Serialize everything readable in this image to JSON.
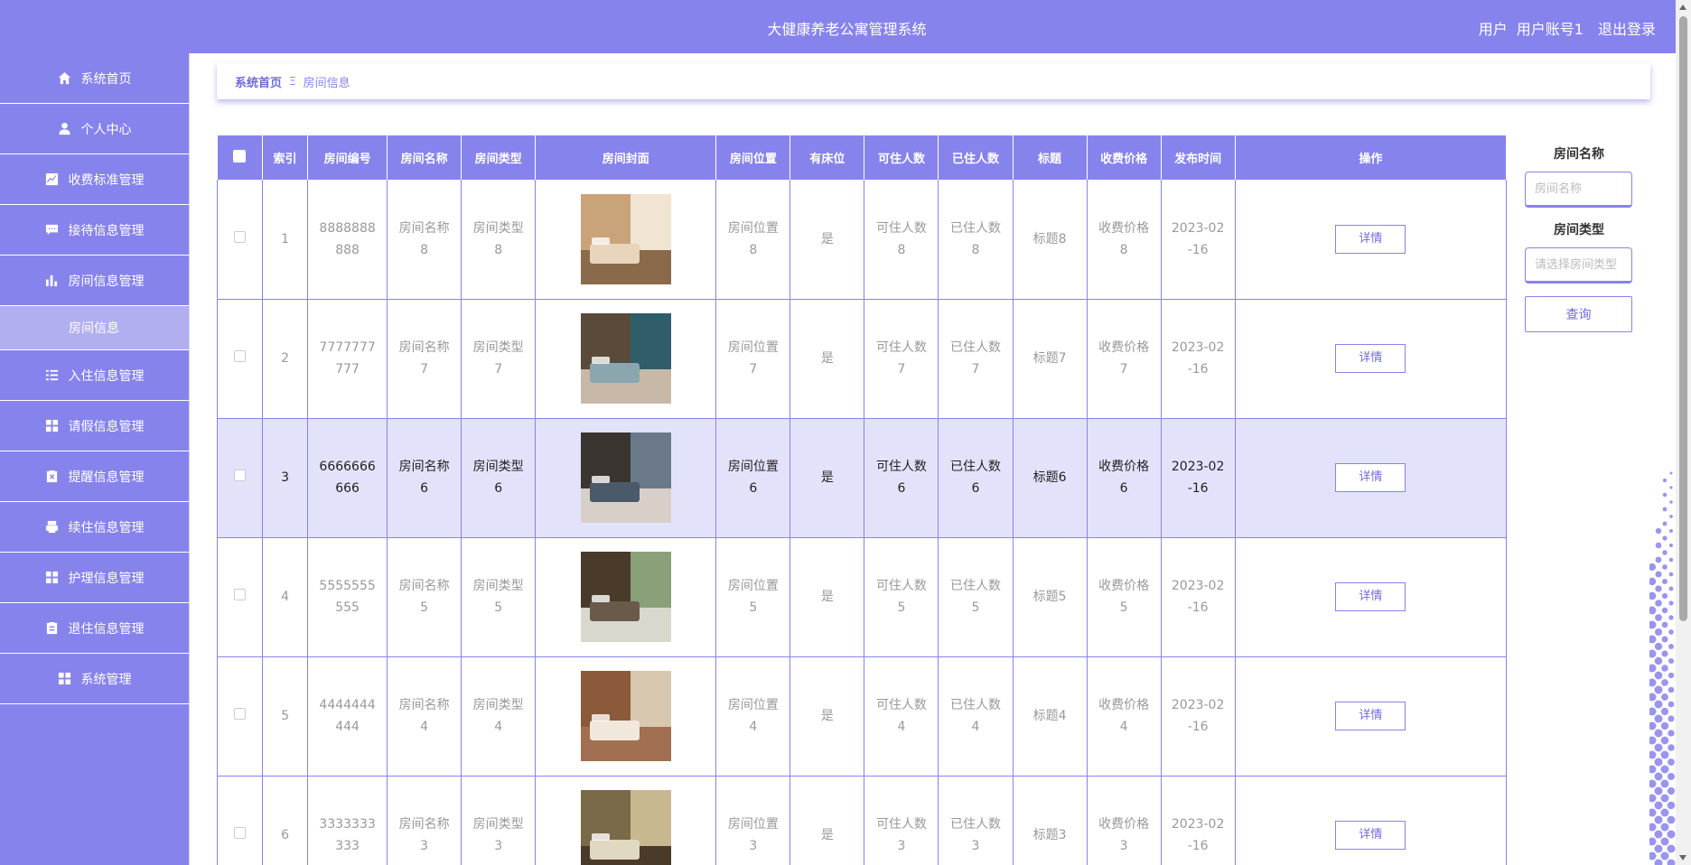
{
  "header": {
    "title": "大健康养老公寓管理系统",
    "role": "用户",
    "account": "用户账号1",
    "logout": "退出登录"
  },
  "sidebar": {
    "items": [
      {
        "label": "系统首页",
        "icon": "home-icon"
      },
      {
        "label": "个人中心",
        "icon": "user-icon"
      },
      {
        "label": "收费标准管理",
        "icon": "chart-line-icon"
      },
      {
        "label": "接待信息管理",
        "icon": "chat-icon"
      },
      {
        "label": "房间信息管理",
        "icon": "bar-chart-icon"
      },
      {
        "label": "房间信息",
        "icon": ""
      },
      {
        "label": "入住信息管理",
        "icon": "list-icon"
      },
      {
        "label": "请假信息管理",
        "icon": "grid-icon"
      },
      {
        "label": "提醒信息管理",
        "icon": "clipboard-x-icon"
      },
      {
        "label": "续住信息管理",
        "icon": "printer-icon"
      },
      {
        "label": "护理信息管理",
        "icon": "grid-icon"
      },
      {
        "label": "退住信息管理",
        "icon": "clipboard-icon"
      },
      {
        "label": "系统管理",
        "icon": "grid-icon"
      }
    ]
  },
  "breadcrumb": {
    "home": "系统首页",
    "separator": "Ξ",
    "current": "房间信息"
  },
  "table": {
    "headers": [
      "索引",
      "房间编号",
      "房间名称",
      "房间类型",
      "房间封面",
      "房间位置",
      "有床位",
      "可住人数",
      "已住人数",
      "标题",
      "收费价格",
      "发布时间",
      "操作"
    ],
    "action_label": "详情",
    "rows": [
      {
        "index": "1",
        "code": "8888888888",
        "name": "房间名称8",
        "type": "房间类型8",
        "location": "房间位置8",
        "bed": "是",
        "capacity": "可住人数8",
        "occupied": "已住人数8",
        "title": "标题8",
        "price": "收费价格8",
        "date": "2023-02-16"
      },
      {
        "index": "2",
        "code": "7777777777",
        "name": "房间名称7",
        "type": "房间类型7",
        "location": "房间位置7",
        "bed": "是",
        "capacity": "可住人数7",
        "occupied": "已住人数7",
        "title": "标题7",
        "price": "收费价格7",
        "date": "2023-02-16"
      },
      {
        "index": "3",
        "code": "6666666666",
        "name": "房间名称6",
        "type": "房间类型6",
        "location": "房间位置6",
        "bed": "是",
        "capacity": "可住人数6",
        "occupied": "已住人数6",
        "title": "标题6",
        "price": "收费价格6",
        "date": "2023-02-16"
      },
      {
        "index": "4",
        "code": "5555555555",
        "name": "房间名称5",
        "type": "房间类型5",
        "location": "房间位置5",
        "bed": "是",
        "capacity": "可住人数5",
        "occupied": "已住人数5",
        "title": "标题5",
        "price": "收费价格5",
        "date": "2023-02-16"
      },
      {
        "index": "5",
        "code": "4444444444",
        "name": "房间名称4",
        "type": "房间类型4",
        "location": "房间位置4",
        "bed": "是",
        "capacity": "可住人数4",
        "occupied": "已住人数4",
        "title": "标题4",
        "price": "收费价格4",
        "date": "2023-02-16"
      },
      {
        "index": "6",
        "code": "3333333333",
        "name": "房间名称3",
        "type": "房间类型3",
        "location": "房间位置3",
        "bed": "是",
        "capacity": "可住人数3",
        "occupied": "已住人数3",
        "title": "标题3",
        "price": "收费价格3",
        "date": "2023-02-16"
      }
    ]
  },
  "search": {
    "name_label": "房间名称",
    "name_placeholder": "房间名称",
    "type_label": "房间类型",
    "type_placeholder": "请选择房间类型",
    "query_label": "查询"
  },
  "colors": {
    "accent": "#8783ec",
    "highlight_row": "#e3e2fb",
    "sidebar_active": "#b2aff0"
  }
}
